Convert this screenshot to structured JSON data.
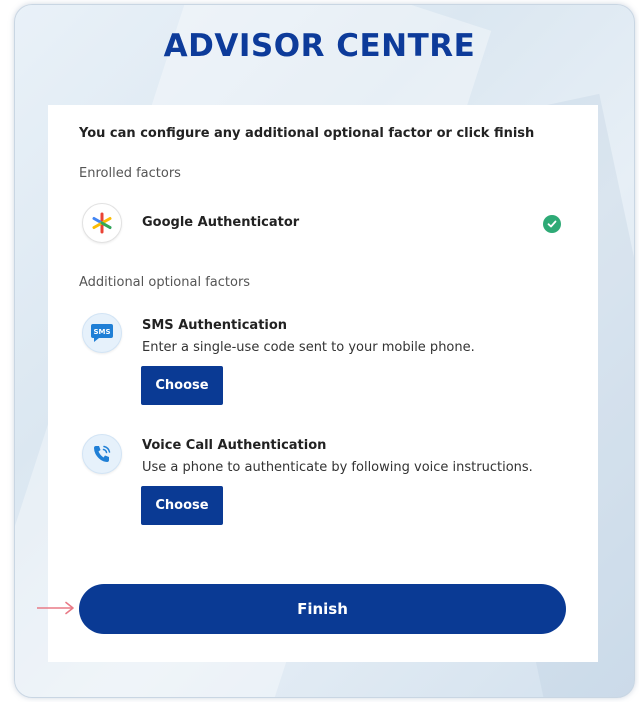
{
  "brand": {
    "title": "ADVISOR CENTRE"
  },
  "intro": "You can configure any additional optional factor or click finish",
  "enrolled": {
    "label": "Enrolled factors",
    "factors": [
      {
        "name": "Google Authenticator",
        "icon": "google-authenticator-icon",
        "status_icon": "check-circle-icon"
      }
    ]
  },
  "optional": {
    "label": "Additional optional factors",
    "factors": [
      {
        "name": "SMS Authentication",
        "description": "Enter a single-use code sent to your mobile phone.",
        "icon": "sms-icon",
        "icon_text": "SMS",
        "button": "Choose"
      },
      {
        "name": "Voice Call Authentication",
        "description": "Use a phone to authenticate by following voice instructions.",
        "icon": "phone-call-icon",
        "button": "Choose"
      }
    ]
  },
  "finish_button": "Finish",
  "colors": {
    "primary": "#0a3a94",
    "brand_text": "#0d3b9a",
    "success": "#2eaa76",
    "annotation_arrow": "#e87a86"
  }
}
